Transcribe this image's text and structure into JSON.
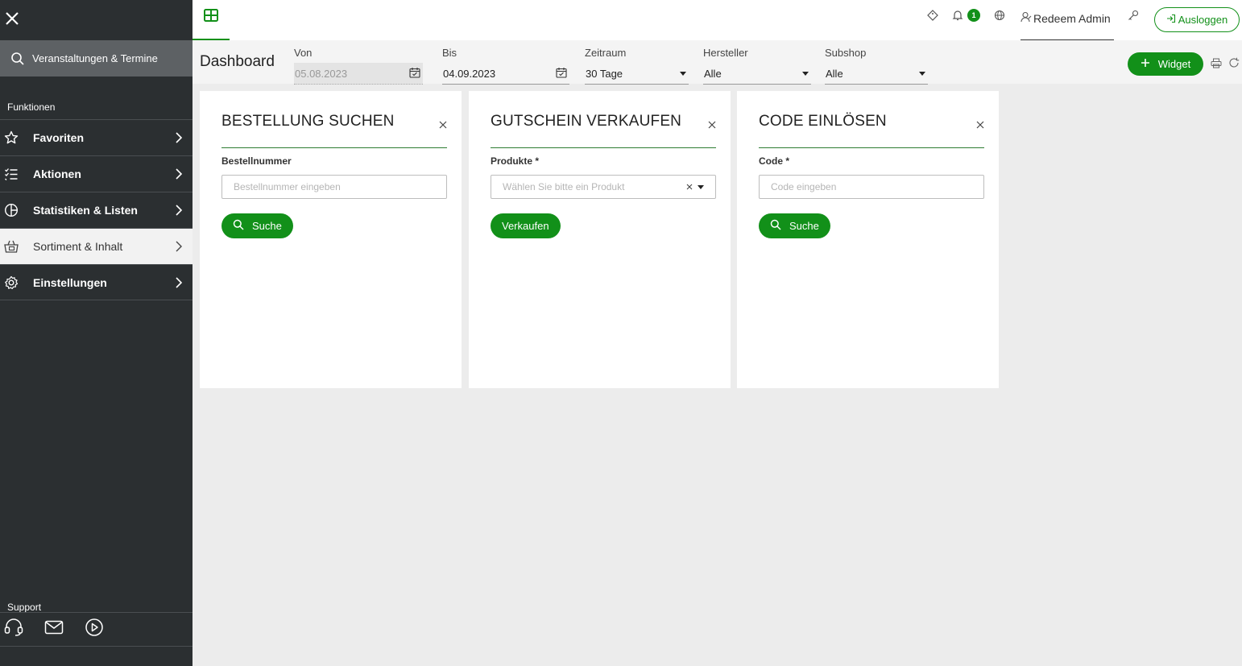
{
  "sidebar": {
    "search_label": "Veranstaltungen & Termine",
    "section_functions": "Funktionen",
    "items": [
      {
        "label": "Favoriten"
      },
      {
        "label": "Aktionen"
      },
      {
        "label": "Statistiken & Listen"
      },
      {
        "label": "Sortiment & Inhalt"
      },
      {
        "label": "Einstellungen"
      }
    ],
    "section_support": "Support"
  },
  "topbar": {
    "notification_count": "1",
    "user_name": "Redeem Admin",
    "logout_label": "Ausloggen"
  },
  "filters": {
    "page_title": "Dashboard",
    "from_label": "Von",
    "from_value": "05.08.2023",
    "to_label": "Bis",
    "to_value": "04.09.2023",
    "period_label": "Zeitraum",
    "period_value": "30 Tage",
    "manufacturer_label": "Hersteller",
    "manufacturer_value": "Alle",
    "subshop_label": "Subshop",
    "subshop_value": "Alle",
    "widget_button": "Widget"
  },
  "cards": [
    {
      "title": "BESTELLUNG SUCHEN",
      "field_label": "Bestellnummer",
      "placeholder": "Bestellnummer eingeben",
      "button": "Suche"
    },
    {
      "title": "GUTSCHEIN VERKAUFEN",
      "field_label": "Produkte *",
      "placeholder": "Wählen Sie bitte ein Produkt",
      "button": "Verkaufen"
    },
    {
      "title": "CODE EINLÖSEN",
      "field_label": "Code *",
      "placeholder": "Code eingeben",
      "button": "Suche"
    }
  ],
  "colors": {
    "accent": "#129019",
    "sidebar_bg": "#2b2f31"
  }
}
